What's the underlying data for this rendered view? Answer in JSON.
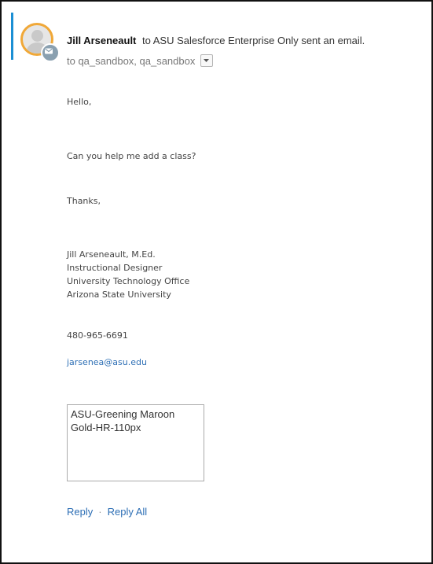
{
  "header": {
    "sender": "Jill Arseneault",
    "action": "to ASU Salesforce Enterprise Only sent an email.",
    "to": "to qa_sandbox, qa_sandbox"
  },
  "icons": {
    "avatar": "avatar-placeholder",
    "badge": "email-icon",
    "dropdown": "caret-down-icon"
  },
  "colors": {
    "accent_bar": "#1b8fd4",
    "avatar_ring": "#f0a838",
    "link": "#2e6fb5"
  },
  "body": {
    "greeting": "Hello,",
    "message": "Can you help me add a class?",
    "closing": "Thanks,"
  },
  "signature": {
    "lines": [
      "Jill Arseneault, M.Ed.",
      "Instructional Designer",
      "University Technology Office",
      "Arizona State University"
    ],
    "phone": "480-965-6691",
    "email": "jarsenea@asu.edu"
  },
  "image_placeholder": {
    "alt_line1": "ASU-Greening Maroon",
    "alt_line2": "Gold-HR-110px"
  },
  "actions": {
    "reply": "Reply",
    "separator": "·",
    "reply_all": "Reply All"
  }
}
